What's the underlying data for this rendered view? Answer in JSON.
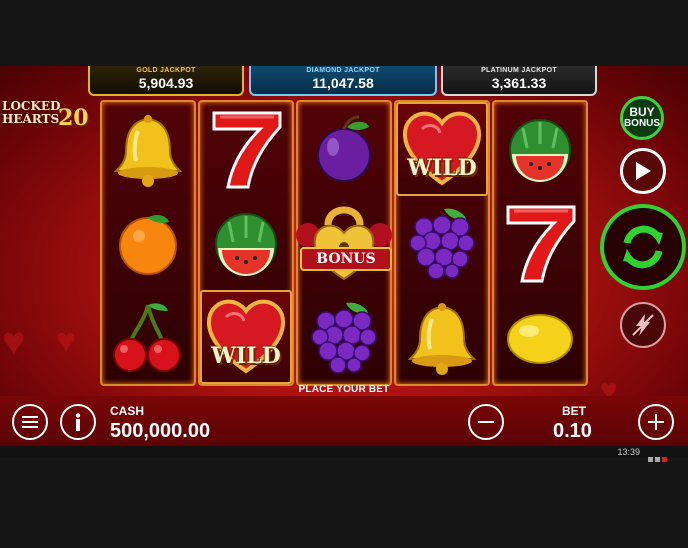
{
  "game": {
    "logo_text": "LOCKED\nHEARTS",
    "logo_number": "20"
  },
  "jackpots": [
    {
      "label": "GOLD JACKPOT",
      "value": "5,904.93",
      "color": "#e0b52a"
    },
    {
      "label": "DIAMOND JACKPOT",
      "value": "11,047.58",
      "color": "#7ac8f0"
    },
    {
      "label": "PLATINUM JACKPOT",
      "value": "3,361.33",
      "color": "#d8d8d8"
    }
  ],
  "reels": [
    [
      "bell",
      "orange",
      "cherries"
    ],
    [
      "seven",
      "watermelon",
      "wild"
    ],
    [
      "plum",
      "bonus",
      "grapes"
    ],
    [
      "wild",
      "grapes",
      "bell"
    ],
    [
      "watermelon",
      "seven",
      "lemon"
    ]
  ],
  "symbols": {
    "wild_label": "WILD",
    "bonus_label": "BONUS"
  },
  "message": "PLACE YOUR BET",
  "buy_bonus": {
    "line1": "BUY",
    "line2": "BONUS"
  },
  "cash": {
    "label": "CASH",
    "value": "500,000.00"
  },
  "bet": {
    "label": "BET",
    "value": "0.10"
  },
  "status_bar": {
    "time": "13:39"
  },
  "colors": {
    "spin_ring": "#2fd22f",
    "reel_border": "#d98a2c",
    "background": "#b01412"
  },
  "icons": [
    "menu-icon",
    "info-icon",
    "minus-icon",
    "plus-icon",
    "play-icon",
    "spin-icon",
    "turbo-icon"
  ]
}
